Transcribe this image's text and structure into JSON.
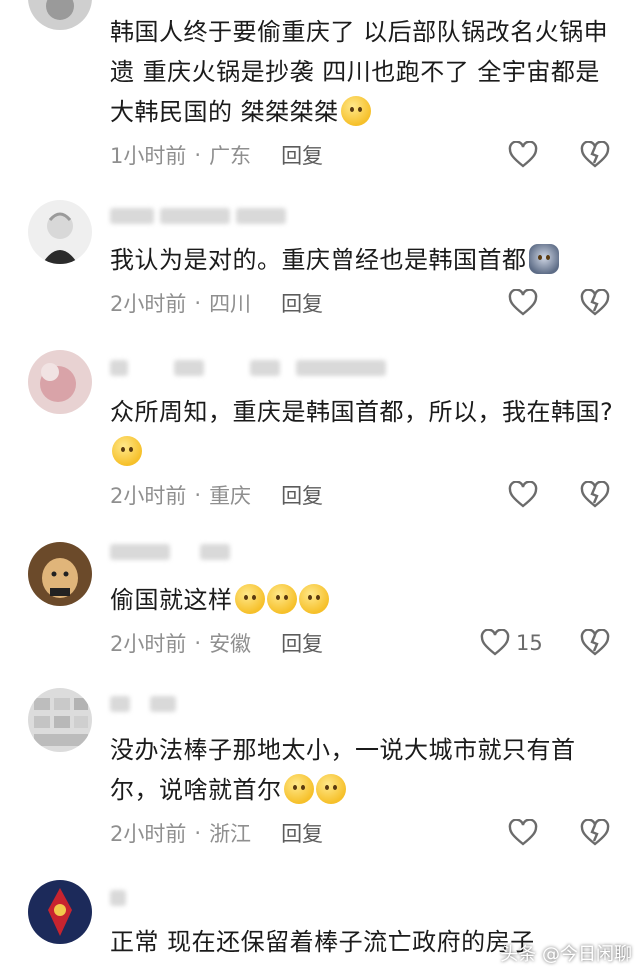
{
  "comments": [
    {
      "text": "韩国人终于要偷重庆了 以后部队锅改名火锅申遗 重庆火锅是抄袭 四川也跑不了 全宇宙都是大韩民国的 桀桀桀桀",
      "emoji": "crying-laugh-emoji",
      "time": "1小时前",
      "location": "广东",
      "reply": "回复",
      "likes": ""
    },
    {
      "text": "我认为是对的。重庆曾经也是韩国首都",
      "emoji": "husky-emoji",
      "time": "2小时前",
      "location": "四川",
      "reply": "回复",
      "likes": ""
    },
    {
      "text": "众所周知，重庆是韩国首都，所以，我在韩国?",
      "emoji": "smile-emoji",
      "time": "2小时前",
      "location": "重庆",
      "reply": "回复",
      "likes": ""
    },
    {
      "text": "偷国就这样",
      "emoji": "smirk-emoji",
      "time": "2小时前",
      "location": "安徽",
      "reply": "回复",
      "likes": "15"
    },
    {
      "text": "没办法棒子那地太小，一说大城市就只有首尔，说啥就首尔",
      "emoji": "rofl-emoji",
      "time": "2小时前",
      "location": "浙江",
      "reply": "回复",
      "likes": ""
    },
    {
      "text": "正常 现在还保留着棒子流亡政府的房子",
      "emoji": "",
      "time": "",
      "location": "",
      "reply": "",
      "likes": ""
    }
  ],
  "separator": "·",
  "watermark": "头条 @今日闲聊",
  "colors": {
    "text": "#1b1b1b",
    "meta": "#8f8f8f",
    "icon": "#6b6b6b"
  }
}
